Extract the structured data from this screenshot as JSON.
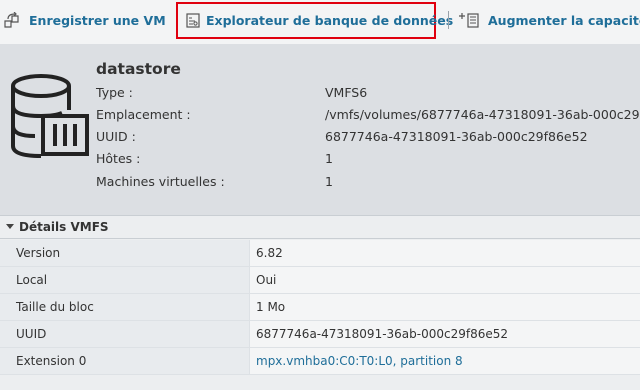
{
  "toolbar": {
    "register_vm": "Enregistrer une VM",
    "datastore_browser": "Explorateur de banque de données",
    "increase_capacity": "Augmenter la capacité",
    "icons": [
      "register-vm-icon",
      "datastore-browser-icon",
      "increase-capacity-icon"
    ],
    "highlight_color": "#e0000f",
    "accent_color": "#1f6e99"
  },
  "summary": {
    "title": "datastore",
    "properties": [
      {
        "label": "Type :",
        "value": "VMFS6"
      },
      {
        "label": "Emplacement :",
        "value": "/vmfs/volumes/6877746a-47318091-36ab-000c29"
      },
      {
        "label": "UUID :",
        "value": "6877746a-47318091-36ab-000c29f86e52"
      },
      {
        "label": "Hôtes :",
        "value": "1"
      },
      {
        "label": "Machines virtuelles :",
        "value": "1"
      }
    ]
  },
  "details": {
    "title": "Détails VMFS",
    "rows": [
      {
        "key": "Version",
        "value": "6.82"
      },
      {
        "key": "Local",
        "value": "Oui"
      },
      {
        "key": "Taille du bloc",
        "value": "1 Mo"
      },
      {
        "key": "UUID",
        "value": "6877746a-47318091-36ab-000c29f86e52"
      },
      {
        "key": "Extension 0",
        "value": "mpx.vmhba0:C0:T0:L0, partition 8"
      }
    ]
  }
}
